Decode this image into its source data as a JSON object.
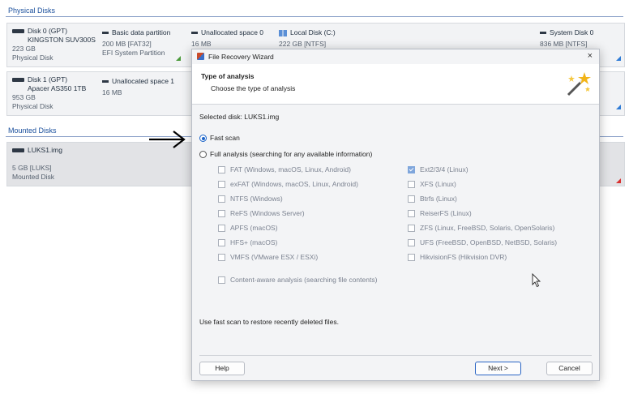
{
  "sections": {
    "physical_disks": "Physical Disks",
    "mounted_disks": "Mounted Disks"
  },
  "disk0": {
    "name": "Disk 0 (GPT)",
    "model": "KINGSTON SUV300S",
    "size": "223 GB",
    "type": "Physical Disk",
    "partitions": [
      {
        "name": "Basic data partition",
        "detail": "200 MB [FAT32]",
        "detail2": "EFI System Partition"
      },
      {
        "name": "Unallocated space 0",
        "detail": "16 MB"
      },
      {
        "name": "Local Disk (C:)",
        "detail": "222 GB [NTFS]"
      },
      {
        "name": "System Disk 0",
        "detail": "836 MB [NTFS]"
      }
    ]
  },
  "disk1": {
    "name": "Disk 1 (GPT)",
    "model": "Apacer AS350 1TB",
    "size": "953 GB",
    "type": "Physical Disk",
    "partitions": [
      {
        "name": "Unallocated space 1",
        "detail": "16 MB"
      }
    ]
  },
  "mounted": {
    "name": "LUKS1.img",
    "size": "5 GB [LUKS]",
    "type": "Mounted Disk"
  },
  "dialog": {
    "title": "File Recovery Wizard",
    "close": "×",
    "header_title": "Type of analysis",
    "header_subtitle": "Choose the type of analysis",
    "selected_disk": "Selected disk: LUKS1.img",
    "fast_scan": "Fast scan",
    "full_analysis": "Full analysis (searching for any available information)",
    "fs_left": [
      "FAT (Windows, macOS, Linux, Android)",
      "exFAT (Windows, macOS, Linux, Android)",
      "NTFS (Windows)",
      "ReFS (Windows Server)",
      "APFS (macOS)",
      "HFS+ (macOS)",
      "VMFS (VMware ESX / ESXi)"
    ],
    "fs_right": [
      "Ext2/3/4 (Linux)",
      "XFS (Linux)",
      "Btrfs (Linux)",
      "ReiserFS (Linux)",
      "ZFS (Linux, FreeBSD, Solaris, OpenSolaris)",
      "UFS (FreeBSD, OpenBSD, NetBSD, Solaris)",
      "HikvisionFS (Hikvision DVR)"
    ],
    "content_aware": "Content-aware analysis (searching file contents)",
    "hint": "Use fast scan to restore recently deleted files.",
    "help_button": "Help",
    "next_button": "Next >",
    "cancel_button": "Cancel"
  },
  "colors": {
    "accent": "#1a63c8",
    "section_header": "#1a4f9c"
  }
}
